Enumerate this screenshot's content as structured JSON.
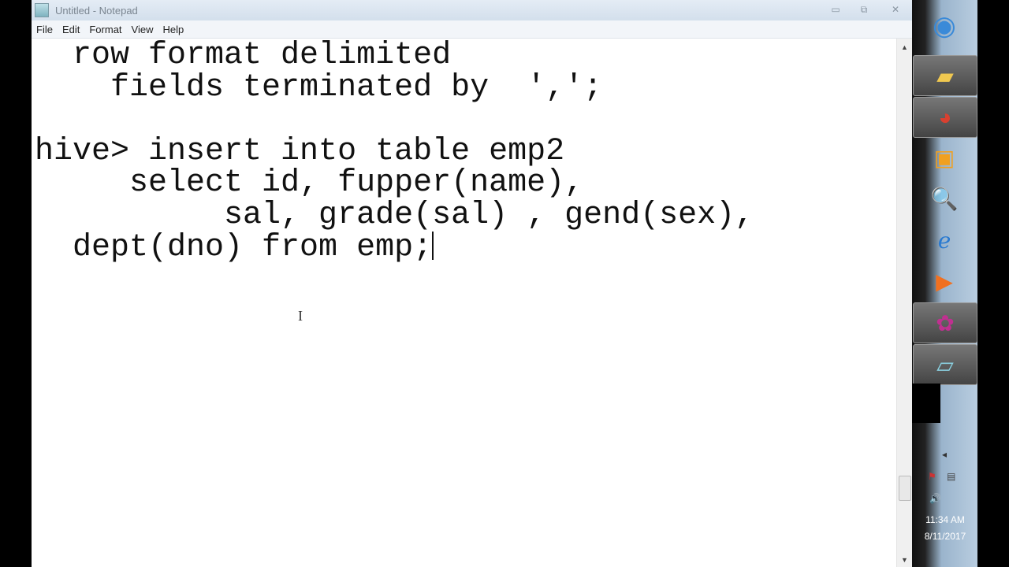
{
  "window": {
    "title": "Untitled - Notepad",
    "minimize": "▭",
    "restore": "⧉",
    "close": "✕"
  },
  "menu": [
    "File",
    "Edit",
    "Format",
    "View",
    "Help"
  ],
  "editor": {
    "lines": [
      "  row format delimited",
      "    fields terminated by  ',';",
      "",
      "hive> insert into table emp2",
      "     select id, fupper(name),",
      "          sal, grade(sal) , gend(sex),",
      "  dept(dno) from emp;"
    ]
  },
  "scrollbar": {
    "up": "▲",
    "down": "▼"
  },
  "taskbar": {
    "items": [
      "start-orb",
      "windows-explorer",
      "google-chrome",
      "vmware",
      "photo-viewer",
      "internet-explorer",
      "media-player",
      "app-flower",
      "notepad"
    ]
  },
  "tray": {
    "time": "11:34 AM",
    "date": "8/11/2017"
  }
}
